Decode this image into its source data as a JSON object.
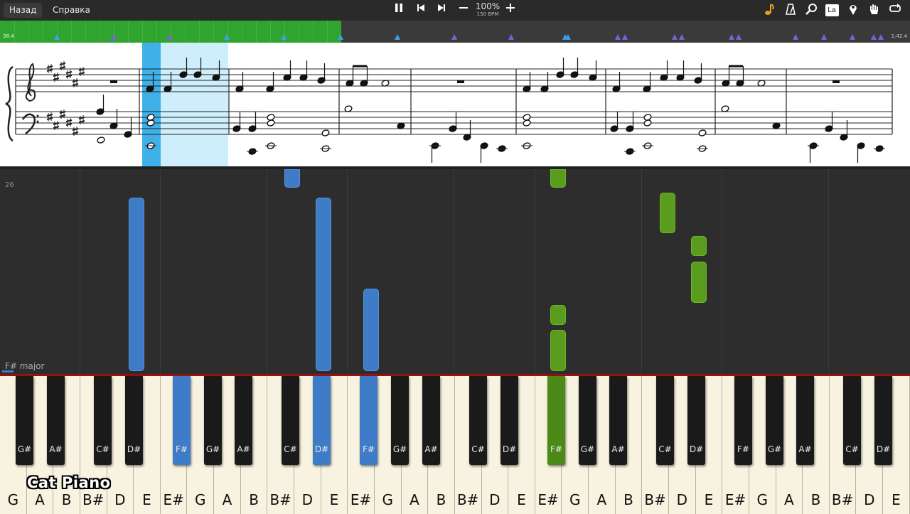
{
  "toolbar": {
    "back_label": "Назад",
    "help_label": "Справка",
    "tempo_percent": "100%",
    "tempo_bpm": "150 BPM",
    "icons": [
      "pause-icon",
      "prev-icon",
      "next-icon",
      "minus-icon",
      "plus-icon",
      "note-icon",
      "metronome-icon",
      "magnifier-icon",
      "la-icon",
      "pin-icon",
      "hand-icon",
      "loop-icon"
    ],
    "la_label": "La"
  },
  "timeline": {
    "start_label": "38.4",
    "end_label": "1:42.4",
    "progress_fraction": 0.375,
    "accent_green": "#2fa42f",
    "marker_purple": "#7d5fd8",
    "marker_blue": "#38a0e8"
  },
  "roll": {
    "bar_number": "26",
    "key_signature": "F# major",
    "left_hand_color": "#3f7cc8",
    "right_hand_color": "#5a9c1e"
  },
  "keyboard": {
    "white_labels": [
      "G",
      "A",
      "B",
      "B#",
      "D",
      "E",
      "E#",
      "G",
      "A",
      "B",
      "B#",
      "D",
      "E",
      "E#",
      "G",
      "A",
      "B",
      "B#",
      "D",
      "E",
      "E#",
      "G",
      "A",
      "B",
      "B#",
      "D",
      "E",
      "E#",
      "G",
      "A",
      "B",
      "B#",
      "D",
      "E"
    ],
    "black_labels": [
      "G#",
      "A#",
      "C#",
      "D#",
      "F#",
      "G#",
      "A#",
      "C#",
      "D#",
      "F#",
      "G#",
      "A#",
      "C#",
      "D#",
      "F#",
      "G#",
      "A#",
      "C#",
      "D#",
      "F#",
      "G#",
      "A#",
      "C#",
      "D#"
    ]
  },
  "watermark": "Cat Piano"
}
